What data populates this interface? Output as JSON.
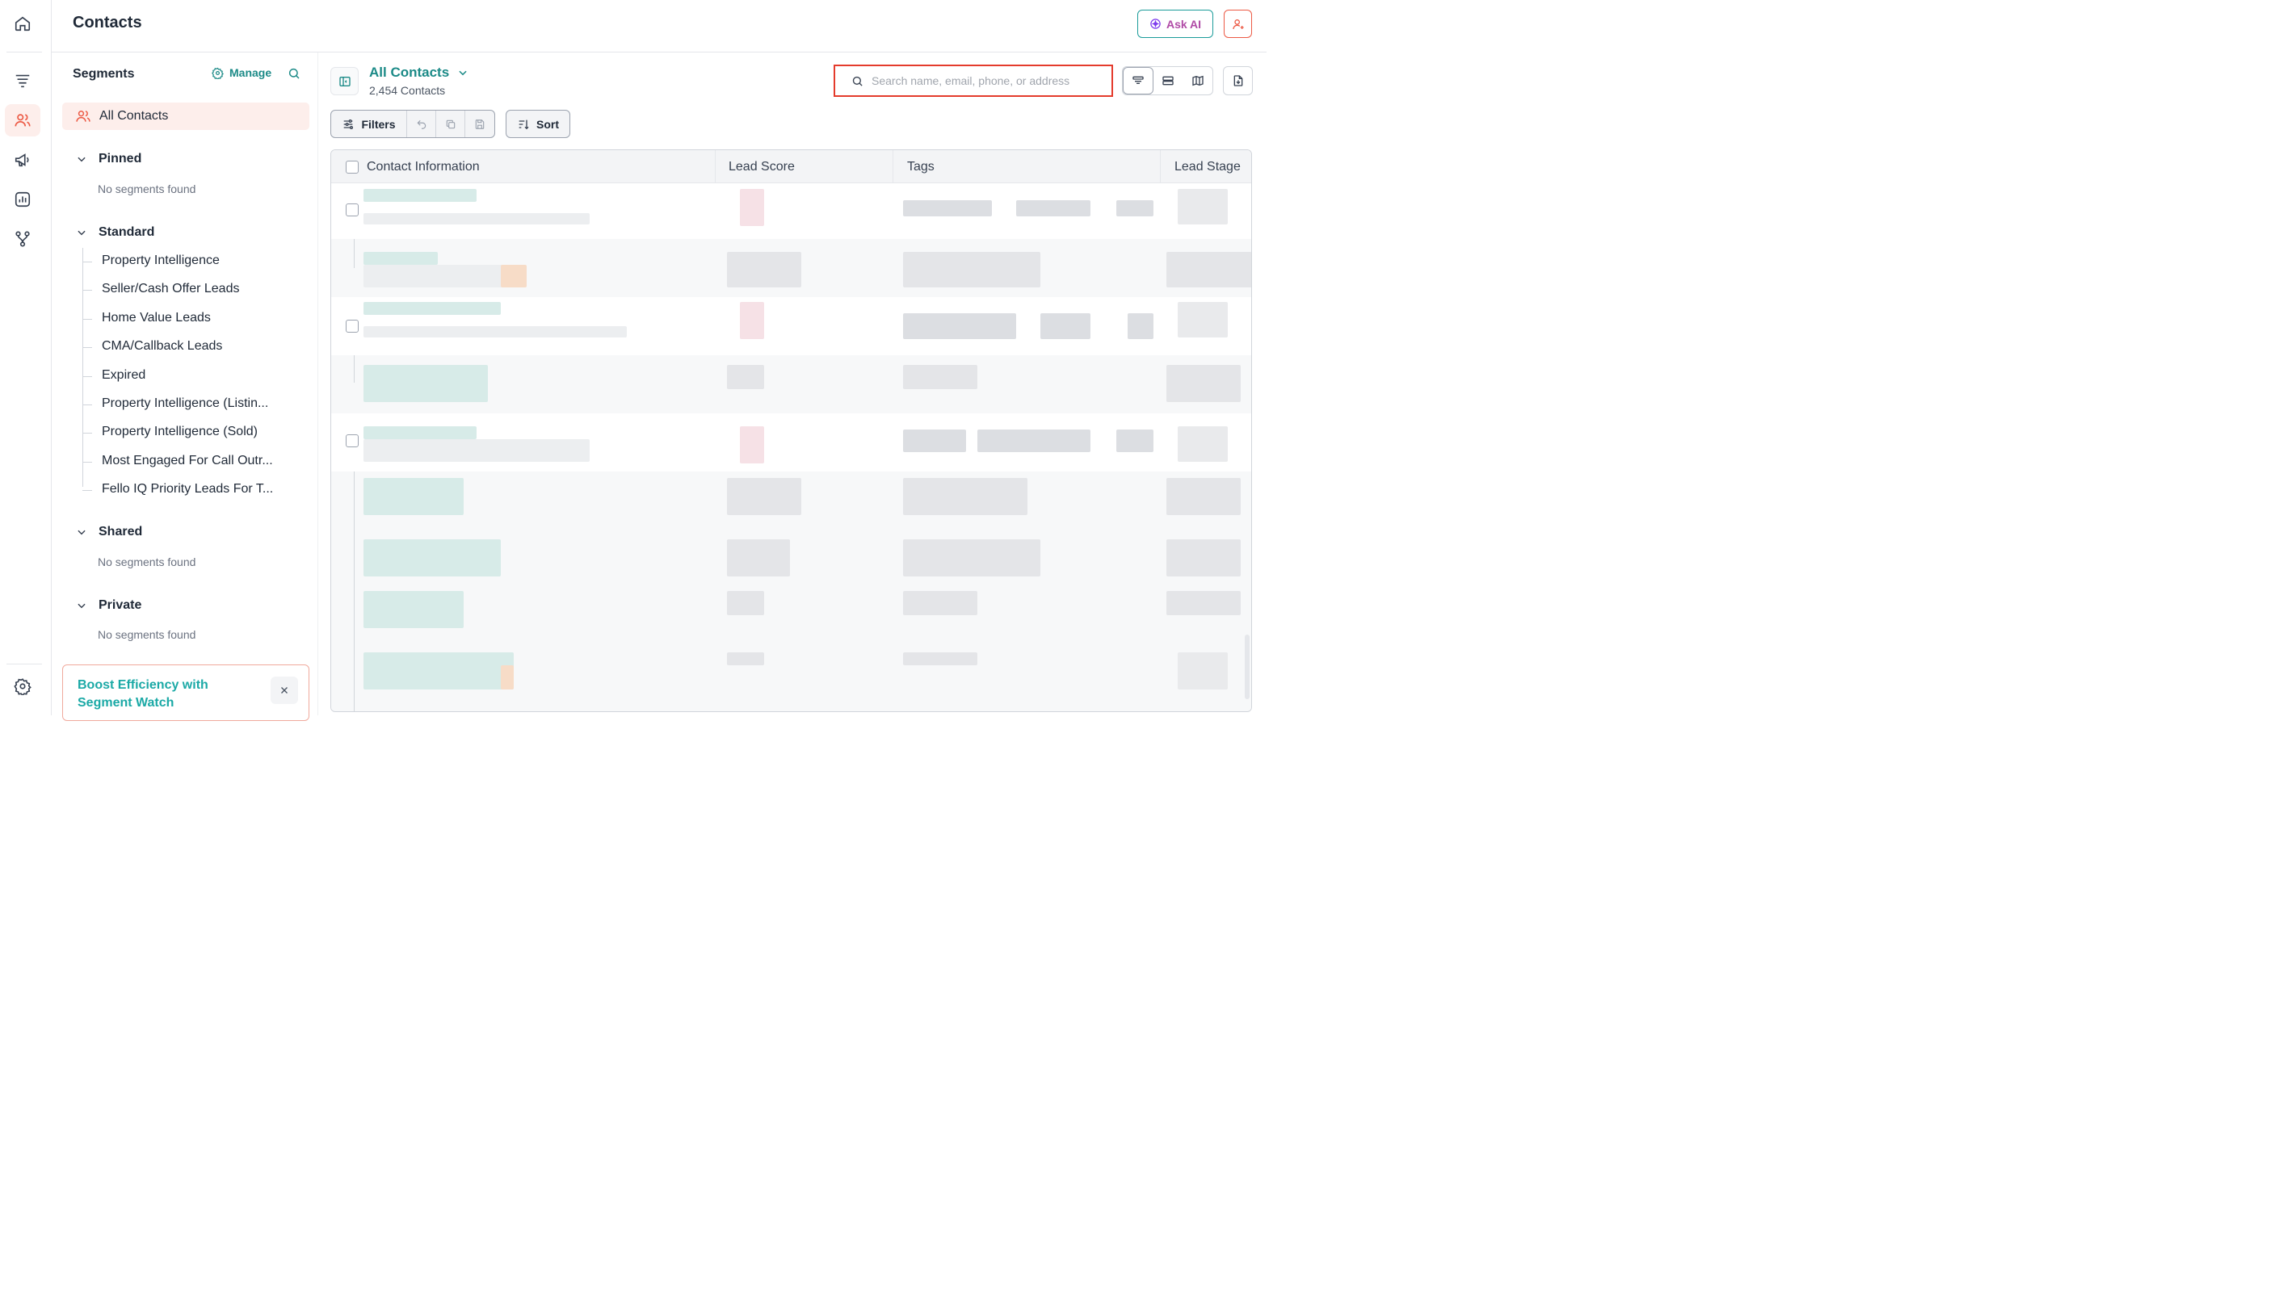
{
  "header": {
    "title": "Contacts",
    "ask_ai_label": "Ask AI"
  },
  "rail": {
    "items": [
      {
        "icon": "home-icon"
      },
      {
        "icon": "funnel-icon"
      },
      {
        "icon": "users-icon",
        "active": true
      },
      {
        "icon": "megaphone-icon"
      },
      {
        "icon": "chart-icon"
      },
      {
        "icon": "workflow-icon"
      }
    ],
    "bottom": [
      {
        "icon": "gear-icon"
      }
    ]
  },
  "segments": {
    "title": "Segments",
    "manage_label": "Manage",
    "all_contacts_label": "All Contacts",
    "groups": {
      "pinned": {
        "label": "Pinned",
        "empty_text": "No segments found"
      },
      "standard": {
        "label": "Standard",
        "items": [
          "Property Intelligence",
          "Seller/Cash Offer Leads",
          "Home Value Leads",
          "CMA/Callback Leads",
          "Expired",
          "Property Intelligence (Listin...",
          "Property Intelligence (Sold)",
          "Most Engaged For Call Outr...",
          "Fello IQ Priority Leads For T..."
        ]
      },
      "shared": {
        "label": "Shared",
        "empty_text": "No segments found"
      },
      "private": {
        "label": "Private",
        "empty_text": "No segments found"
      }
    },
    "promo": {
      "line1": "Boost Efficiency with",
      "line2": "Segment Watch"
    }
  },
  "main": {
    "list_title": "All Contacts",
    "list_count": "2,454 Contacts",
    "search": {
      "placeholder": "Search name, email, phone, or address",
      "value": ""
    },
    "toolbar": {
      "filters_label": "Filters",
      "sort_label": "Sort"
    },
    "table": {
      "columns": [
        "Contact Information",
        "Lead Score",
        "Tags",
        "Lead Stage"
      ]
    }
  },
  "colors": {
    "accent": "#1b8a87",
    "brand": "#ec5a45",
    "highlight_border": "#e43b2c"
  }
}
